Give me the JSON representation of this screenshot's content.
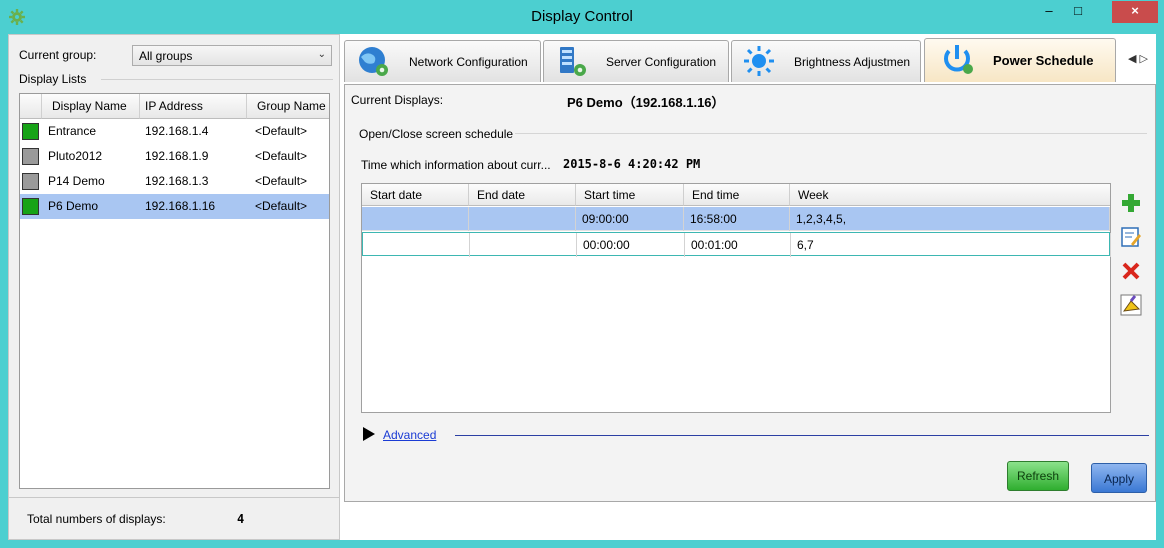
{
  "window": {
    "title": "Display Control",
    "controls": {
      "minimize": "–",
      "maximize": "□",
      "close": "×"
    }
  },
  "left_panel": {
    "current_group_label": "Current group:",
    "group_select": {
      "value": "All groups",
      "arrow": "⌄"
    },
    "display_lists_label": "Display Lists",
    "columns": [
      "Display Name",
      "IP Address",
      "Group Name"
    ],
    "rows": [
      {
        "name": "Entrance",
        "ip": "192.168.1.4",
        "group": "<Default>",
        "status": "green"
      },
      {
        "name": "Pluto2012",
        "ip": "192.168.1.9",
        "group": "<Default>",
        "status": "gray"
      },
      {
        "name": "P14 Demo",
        "ip": "192.168.1.3",
        "group": "<Default>",
        "status": "gray"
      },
      {
        "name": "P6 Demo",
        "ip": "192.168.1.16",
        "group": "<Default>",
        "status": "green",
        "selected": true
      }
    ],
    "total_label": "Total numbers of displays:",
    "total_value": "4"
  },
  "tabs": [
    {
      "label": "Network Configuration",
      "icon": "globe-gear-icon"
    },
    {
      "label": "Server Configuration",
      "icon": "server-gear-icon"
    },
    {
      "label": "Brightness Adjustmen",
      "icon": "sun-icon"
    },
    {
      "label": "Power Schedule",
      "icon": "power-icon",
      "active": true
    }
  ],
  "tab_nav": "◀ ▷",
  "power_schedule": {
    "current_displays_label": "Current Displays:",
    "current_displays_value": "P6 Demo（192.168.1.16）",
    "group_label": "Open/Close screen schedule",
    "time_label": "Time which information about curr...",
    "time_value": "2015-8-6  4:20:42 PM",
    "columns": [
      "Start date",
      "End date",
      "Start time",
      "End time",
      "Week"
    ],
    "rows": [
      {
        "start_date": "",
        "end_date": "",
        "start_time": "09:00:00",
        "end_time": "16:58:00",
        "week": "1,2,3,4,5,",
        "selected": true
      },
      {
        "start_date": "",
        "end_date": "",
        "start_time": "00:00:00",
        "end_time": "00:01:00",
        "week": "6,7"
      }
    ],
    "advanced_label": "Advanced",
    "refresh_label": "Refresh",
    "apply_label": "Apply"
  },
  "colors": {
    "titlebar": "#4ccfd0",
    "selection": "#a9c6f2",
    "status_green": "#17a317",
    "status_gray": "#9a9a9a",
    "close_button": "#c94c4c"
  }
}
